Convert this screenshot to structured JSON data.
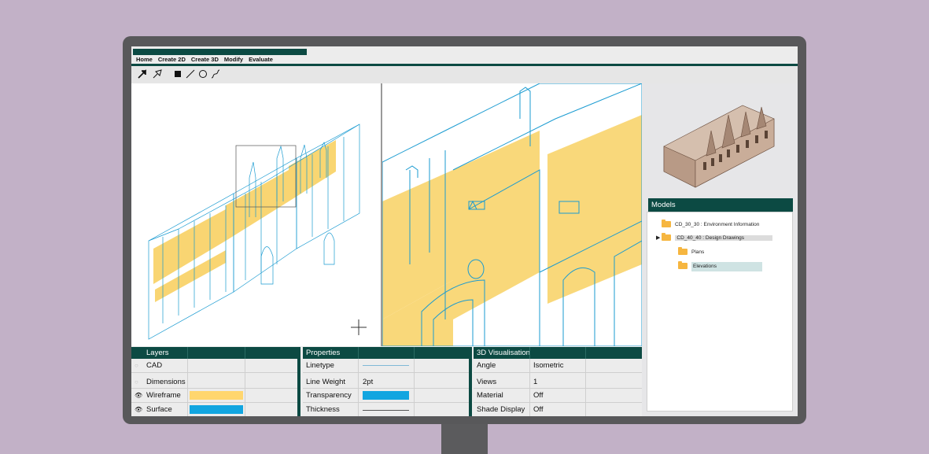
{
  "menu": {
    "items": [
      "Home",
      "Create 2D",
      "Create 3D",
      "Modify",
      "Evaluate"
    ]
  },
  "toolbar": {
    "tools": [
      "select-arrow-icon",
      "direct-select-icon",
      "rectangle-icon",
      "line-icon",
      "circle-icon",
      "curve-icon"
    ]
  },
  "colors": {
    "brand": "#0c4a43",
    "wireframe_blue": "#1a9bd1",
    "fill_yellow": "#f7c843",
    "swatch_yellow": "#ffd66e",
    "swatch_blue": "#11a5e0",
    "folder": "#f6b640",
    "selected_row": "#cfe3e3"
  },
  "models": {
    "title": "Models",
    "items": [
      {
        "label": "CD_30_30 : Environment Information",
        "level": 0,
        "expanded": false,
        "selected": false,
        "highlight": false
      },
      {
        "label": "CD_40_40 : Design Drawings",
        "level": 0,
        "expanded": true,
        "selected": false,
        "highlight": true
      },
      {
        "label": "Plans",
        "level": 1,
        "expanded": false,
        "selected": false,
        "highlight": false
      },
      {
        "label": "Elevations",
        "level": 1,
        "expanded": false,
        "selected": true,
        "highlight": false
      }
    ]
  },
  "layers": {
    "title": "Layers",
    "rows": [
      {
        "name": "CAD",
        "visible": false,
        "swatch": ""
      },
      {
        "name": "Dimensions",
        "visible": false,
        "swatch": ""
      },
      {
        "name": "Wireframe",
        "visible": true,
        "swatch": "#ffd66e"
      },
      {
        "name": "Surface",
        "visible": true,
        "swatch": "#11a5e0"
      }
    ]
  },
  "properties": {
    "title": "Properties",
    "rows": [
      {
        "name": "Linetype",
        "value": "",
        "kind": "line-blue"
      },
      {
        "name": "Line Weight",
        "value": "2pt",
        "kind": "text"
      },
      {
        "name": "Transparency",
        "value": "",
        "kind": "swatch-blue"
      },
      {
        "name": "Thickness",
        "value": "",
        "kind": "line-grey"
      }
    ]
  },
  "visualisation": {
    "title": "3D Visualisation",
    "rows": [
      {
        "name": "Angle",
        "value": "Isometric"
      },
      {
        "name": "Views",
        "value": "1"
      },
      {
        "name": "Material",
        "value": "Off"
      },
      {
        "name": "Shade Display",
        "value": "Off"
      }
    ]
  }
}
